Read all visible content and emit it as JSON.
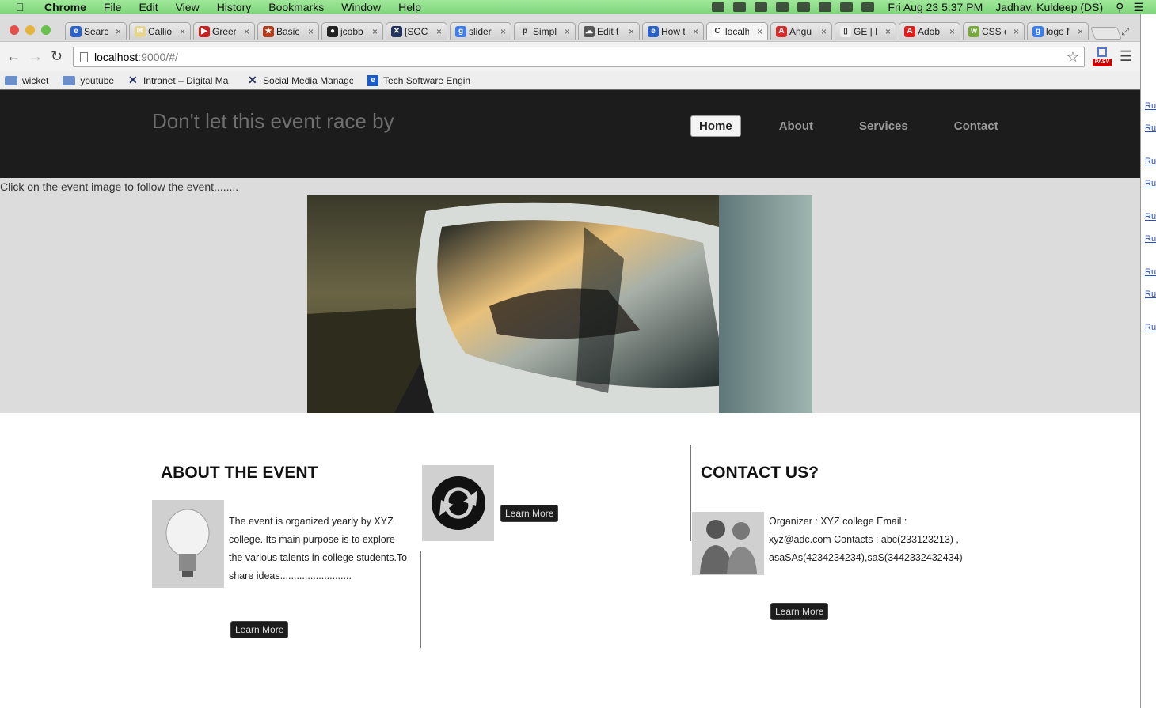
{
  "os_menubar": {
    "app": "Chrome",
    "items": [
      "File",
      "Edit",
      "View",
      "History",
      "Bookmarks",
      "Window",
      "Help"
    ],
    "clock": "Fri Aug 23  5:37 PM",
    "user": "Jadhav, Kuldeep (DS)"
  },
  "browser": {
    "tabs": [
      {
        "label": "Searc",
        "fav_color": "#2b62c9",
        "fav_char": "e"
      },
      {
        "label": "Callio",
        "fav_color": "#e6d48a",
        "fav_char": "✉"
      },
      {
        "label": "Greer",
        "fav_color": "#cc1f1f",
        "fav_char": "▶"
      },
      {
        "label": "Basic",
        "fav_color": "#b23b1a",
        "fav_char": "★"
      },
      {
        "label": "jcobb",
        "fav_color": "#222222",
        "fav_char": "●"
      },
      {
        "label": "[SOCI",
        "fav_color": "#23335e",
        "fav_char": "✕"
      },
      {
        "label": "slider",
        "fav_color": "#3c7df0",
        "fav_char": "g"
      },
      {
        "label": "Simpl",
        "fav_color": "#dddddd",
        "fav_char": "p"
      },
      {
        "label": "Edit t",
        "fav_color": "#555555",
        "fav_char": "☁"
      },
      {
        "label": "How t",
        "fav_color": "#2b62c9",
        "fav_char": "e"
      },
      {
        "label": "localh",
        "fav_color": "#ffffff",
        "fav_char": "C"
      },
      {
        "label": "Angu",
        "fav_color": "#d62b2b",
        "fav_char": "A"
      },
      {
        "label": "GE | F",
        "fav_color": "#eeeeee",
        "fav_char": "▯"
      },
      {
        "label": "Adob",
        "fav_color": "#e31c1c",
        "fav_char": "A"
      },
      {
        "label": "CSS c",
        "fav_color": "#79a83a",
        "fav_char": "w"
      },
      {
        "label": "logo f",
        "fav_color": "#3c7df0",
        "fav_char": "g"
      }
    ],
    "url_host": "localhost",
    "url_path": ":9000/#/",
    "ext_label": "PASV",
    "bookmarks": [
      "wicket",
      "youtube",
      "Intranet – Digital Ma",
      "Social Media Manage",
      "Tech Software Engin"
    ]
  },
  "side_strip_label": "Ru",
  "site": {
    "title": "Don't let this event race by",
    "nav": [
      "Home",
      "About",
      "Services",
      "Contact"
    ],
    "hero_hint": "Click on the event image to follow the event........",
    "about": {
      "title": "ABOUT THE EVENT",
      "text": "The event is organized yearly by XYZ college. Its main purpose is to explore the various talents in college students.To share ideas..........................",
      "button": "Learn More"
    },
    "services": {
      "button": "Learn More"
    },
    "contact": {
      "title": "CONTACT US?",
      "text": "Organizer : XYZ college Email : xyz@adc.com Contacts : abc(233123213) , asaSAs(4234234234),saS(3442332432434)",
      "button": "Learn More"
    }
  },
  "colors": {
    "header_bg": "#1c1c1c",
    "hero_bg": "#dcdcdc",
    "menubar": "#9fe89a"
  }
}
